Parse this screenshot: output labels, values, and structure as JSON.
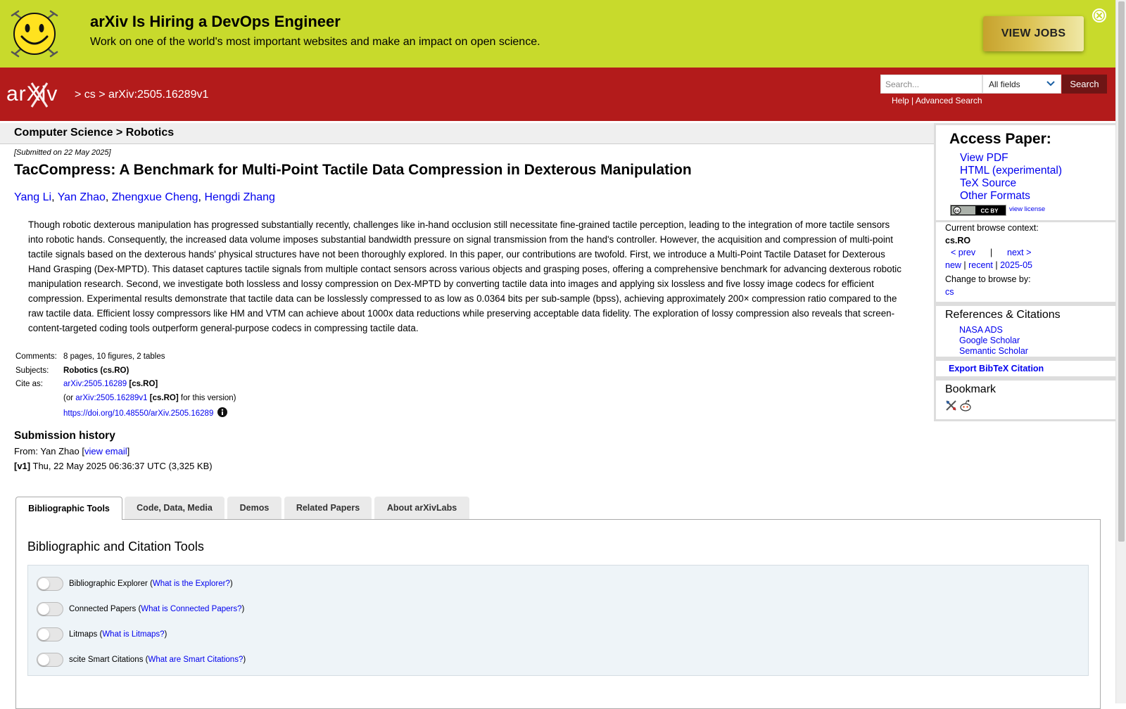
{
  "banner": {
    "title": "arXiv Is Hiring a DevOps Engineer",
    "text": "Work on one of the world's most important websites and make an impact on open science.",
    "button": "VIEW JOBS",
    "accent_color": "#c8da2c"
  },
  "header": {
    "brand_color": "#b31b1b",
    "logo_text": "arXiv",
    "breadcrumb": {
      "sep1": ">",
      "part1": "cs",
      "sep2": ">",
      "part2": "arXiv:2505.16289v1"
    },
    "search": {
      "placeholder": "Search...",
      "field_select": "All fields",
      "button": "Search",
      "help": "Help",
      "divider": "|",
      "advanced": "Advanced Search"
    }
  },
  "paper": {
    "subject_header": "Computer Science > Robotics",
    "submitted": "[Submitted on 22 May 2025]",
    "title": "TacCompress: A Benchmark for Multi-Point Tactile Data Compression in Dexterous Manipulation",
    "authors": [
      "Yang Li",
      "Yan Zhao",
      "Zhengxue Cheng",
      "Hengdi Zhang"
    ],
    "abstract": "Though robotic dexterous manipulation has progressed substantially recently, challenges like in-hand occlusion still necessitate fine-grained tactile perception, leading to the integration of more tactile sensors into robotic hands. Consequently, the increased data volume imposes substantial bandwidth pressure on signal transmission from the hand's controller. However, the acquisition and compression of multi-point tactile signals based on the dexterous hands' physical structures have not been thoroughly explored. In this paper, our contributions are twofold. First, we introduce a Multi-Point Tactile Dataset for Dexterous Hand Grasping (Dex-MPTD). This dataset captures tactile signals from multiple contact sensors across various objects and grasping poses, offering a comprehensive benchmark for advancing dexterous robotic manipulation research. Second, we investigate both lossless and lossy compression on Dex-MPTD by converting tactile data into images and applying six lossless and five lossy image codecs for efficient compression. Experimental results demonstrate that tactile data can be losslessly compressed to as low as 0.0364 bits per sub-sample (bpss), achieving approximately 200× compression ratio compared to the raw tactile data. Efficient lossy compressors like HM and VTM can achieve about 1000x data reductions while preserving acceptable data fidelity. The exploration of lossy compression also reveals that screen-content-targeted coding tools outperform general-purpose codecs in compressing tactile data.",
    "meta": {
      "comments_label": "Comments:",
      "comments": "8 pages, 10 figures, 2 tables",
      "subjects_label": "Subjects:",
      "subjects": "Robotics (cs.RO)",
      "cite_label": "Cite as:",
      "cite_id": "arXiv:2505.16289",
      "cite_cat": "[cs.RO]",
      "cite_or": "(or",
      "cite_version_id": "arXiv:2505.16289v1",
      "cite_version_cat": "[cs.RO]",
      "cite_version_suffix": "for this version)",
      "doi": "https://doi.org/10.48550/arXiv.2505.16289"
    },
    "history": {
      "title": "Submission history",
      "from_prefix": "From: Yan Zhao [",
      "view_email": "view email",
      "from_suffix": "]",
      "version_tag": "[v1]",
      "version_text": "Thu, 22 May 2025 06:36:37 UTC (3,325 KB)"
    }
  },
  "tabs": {
    "items": [
      "Bibliographic Tools",
      "Code, Data, Media",
      "Demos",
      "Related Papers",
      "About arXivLabs"
    ],
    "active": "Bibliographic Tools",
    "panel_title": "Bibliographic and Citation Tools",
    "tools": [
      {
        "label": "Bibliographic Explorer",
        "help": "What is the Explorer?"
      },
      {
        "label": "Connected Papers",
        "help": "What is Connected Papers?"
      },
      {
        "label": "Litmaps",
        "help": "What is Litmaps?"
      },
      {
        "label": "scite Smart Citations",
        "help": "What are Smart Citations?"
      }
    ]
  },
  "sidebar": {
    "access_title": "Access Paper:",
    "access_links": [
      "View PDF",
      "HTML (experimental)",
      "TeX Source",
      "Other Formats"
    ],
    "license_badge": "CC BY",
    "view_license": "view license",
    "context_label": "Current browse context:",
    "context_value": "cs.RO",
    "prev": "< prev",
    "nav_sep": "|",
    "next": "next >",
    "new": "new",
    "recent": "recent",
    "month": "2025-05",
    "change_label": "Change to browse by:",
    "change_value": "cs",
    "refs_title": "References & Citations",
    "refs_links": [
      "NASA ADS",
      "Google Scholar",
      "Semantic Scholar"
    ],
    "export": "Export BibTeX Citation",
    "bookmark_title": "Bookmark",
    "bookmark_icons": [
      "bibsonomy-icon",
      "reddit-icon"
    ]
  }
}
